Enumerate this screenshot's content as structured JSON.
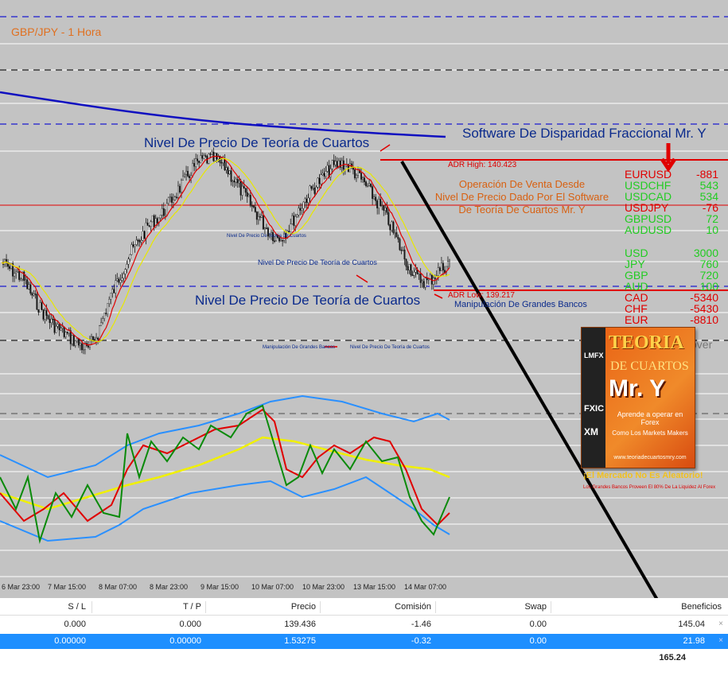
{
  "chart": {
    "title": "GBP/JPY - 1 Hora",
    "labels": {
      "level_top": "Nivel De Precio De Teoría de Cuartos",
      "level_mid_small": "Nivel De Precio De Teoría de Cuartos",
      "level_bottom": "Nivel De Precio De Teoría de Cuartos",
      "level_tiny": "Nivel De Precio De Teoría de Cuartos",
      "manip_tiny": "Manipulación De Grandes Bancos",
      "manip": "Manipulación De Grandes Bancos",
      "adr_high": "ADR High: 140.423",
      "adr_low": "ADR Low: 139.217",
      "sell_note_1": "Operación De Venta Desde",
      "sell_note_2": "Nivel De Precio Dado Por El Software",
      "sell_note_3": "De Teoría De Cuartos Mr. Y",
      "disparity_title": "Software De Disparidad Fraccional Mr. Y",
      "rover": "over"
    },
    "pairs": [
      {
        "name": "EURUSD",
        "value": "-881",
        "color": "#e00000"
      },
      {
        "name": "USDCHF",
        "value": "543",
        "color": "#22cc22"
      },
      {
        "name": "USDCAD",
        "value": "534",
        "color": "#22cc22"
      },
      {
        "name": "USDJPY",
        "value": "-76",
        "color": "#e00000"
      },
      {
        "name": "GBPUSD",
        "value": "72",
        "color": "#22cc22"
      },
      {
        "name": "AUDUSD",
        "value": "10",
        "color": "#22cc22"
      }
    ],
    "currencies": [
      {
        "name": "USD",
        "value": "3000",
        "color": "#22cc22"
      },
      {
        "name": "JPY",
        "value": "760",
        "color": "#22cc22"
      },
      {
        "name": "GBP",
        "value": "720",
        "color": "#22cc22"
      },
      {
        "name": "AUD",
        "value": "100",
        "color": "#22cc22"
      },
      {
        "name": "CAD",
        "value": "-5340",
        "color": "#e00000"
      },
      {
        "name": "CHF",
        "value": "-5430",
        "color": "#e00000"
      },
      {
        "name": "EUR",
        "value": "-8810",
        "color": "#e00000"
      }
    ],
    "time_ticks": [
      "6 Mar 23:00",
      "7 Mar 15:00",
      "8 Mar 07:00",
      "8 Mar 23:00",
      "9 Mar 15:00",
      "10 Mar 07:00",
      "10 Mar 23:00",
      "13 Mar 15:00",
      "14 Mar 07:00"
    ],
    "colors": {
      "background": "#c3c3c3",
      "candle": "#1a1a1a",
      "ma_long": "#1010c0",
      "ma_fast": "#e00000",
      "ma_slow": "#e8e800",
      "level_line_dashed": "#1a1ad0",
      "adr_line": "#e00000",
      "trend_line": "#000000",
      "bands": "#2a90ff",
      "osc_green": "#0a8a0a",
      "osc_red": "#e00000",
      "osc_yellow": "#f0f000"
    }
  },
  "promo": {
    "side_tags": [
      "LMFX",
      "FXIC",
      "XM"
    ],
    "title": "TEORIA",
    "subtitle": "DE CUARTOS",
    "brand": "Mr. Y",
    "line1": "Aprende a operar en Forex",
    "line2": "Como Los Markets Makers",
    "url": "www.teoriadecuartosmry.com",
    "slogan": "¡El Mercado No Es Aleatorio!",
    "sub_slogan": "Los Grandes Bancos Proveen El 80% De La Liquidez Al Forex"
  },
  "terminal": {
    "headers": [
      "S / L",
      "T / P",
      "Precio",
      "Comisión",
      "Swap",
      "Beneficios"
    ],
    "rows": [
      {
        "sl": "0.000",
        "tp": "0.000",
        "price": "139.436",
        "commission": "-1.46",
        "swap": "0.00",
        "profit": "145.04",
        "selected": false
      },
      {
        "sl": "0.00000",
        "tp": "0.00000",
        "price": "1.53275",
        "commission": "-0.32",
        "swap": "0.00",
        "profit": "21.98",
        "selected": true
      }
    ],
    "close_glyph": "×",
    "total": "165.24"
  }
}
